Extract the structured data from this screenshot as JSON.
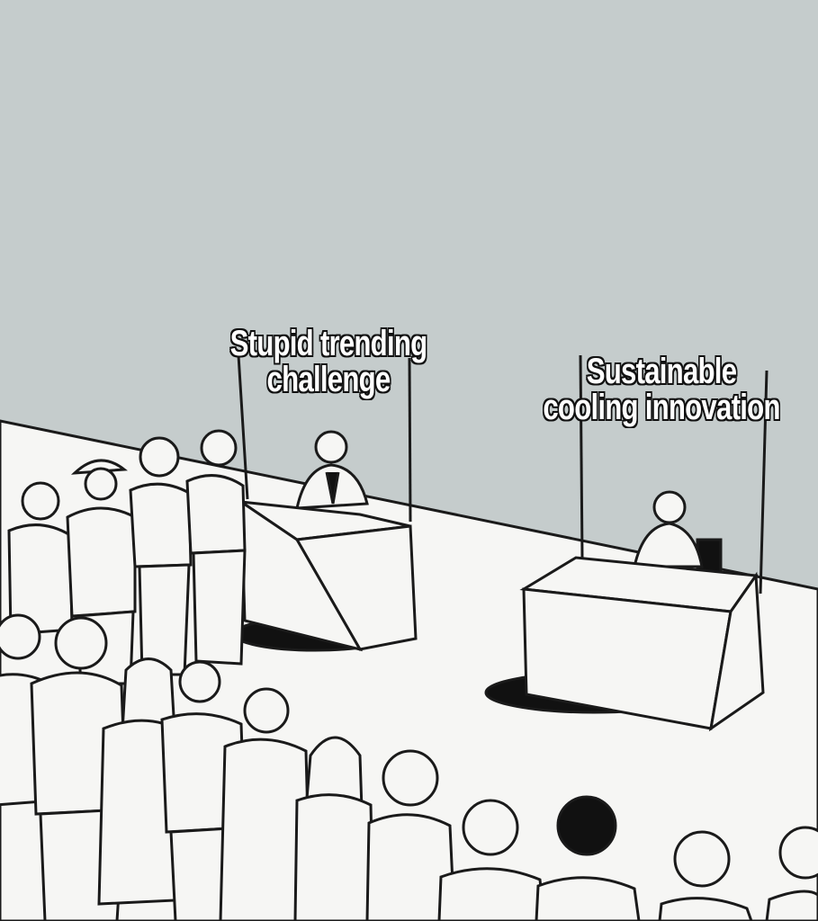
{
  "captions": {
    "left": {
      "line1": "Stupid trending",
      "line2": "challenge"
    },
    "right": {
      "line1": "Sustainable",
      "line2": "cooling innovation"
    }
  },
  "colors": {
    "background": "#c5cccc",
    "floor": "#f6f6f4",
    "ink": "#1a1a1a",
    "shadow": "#111111"
  }
}
